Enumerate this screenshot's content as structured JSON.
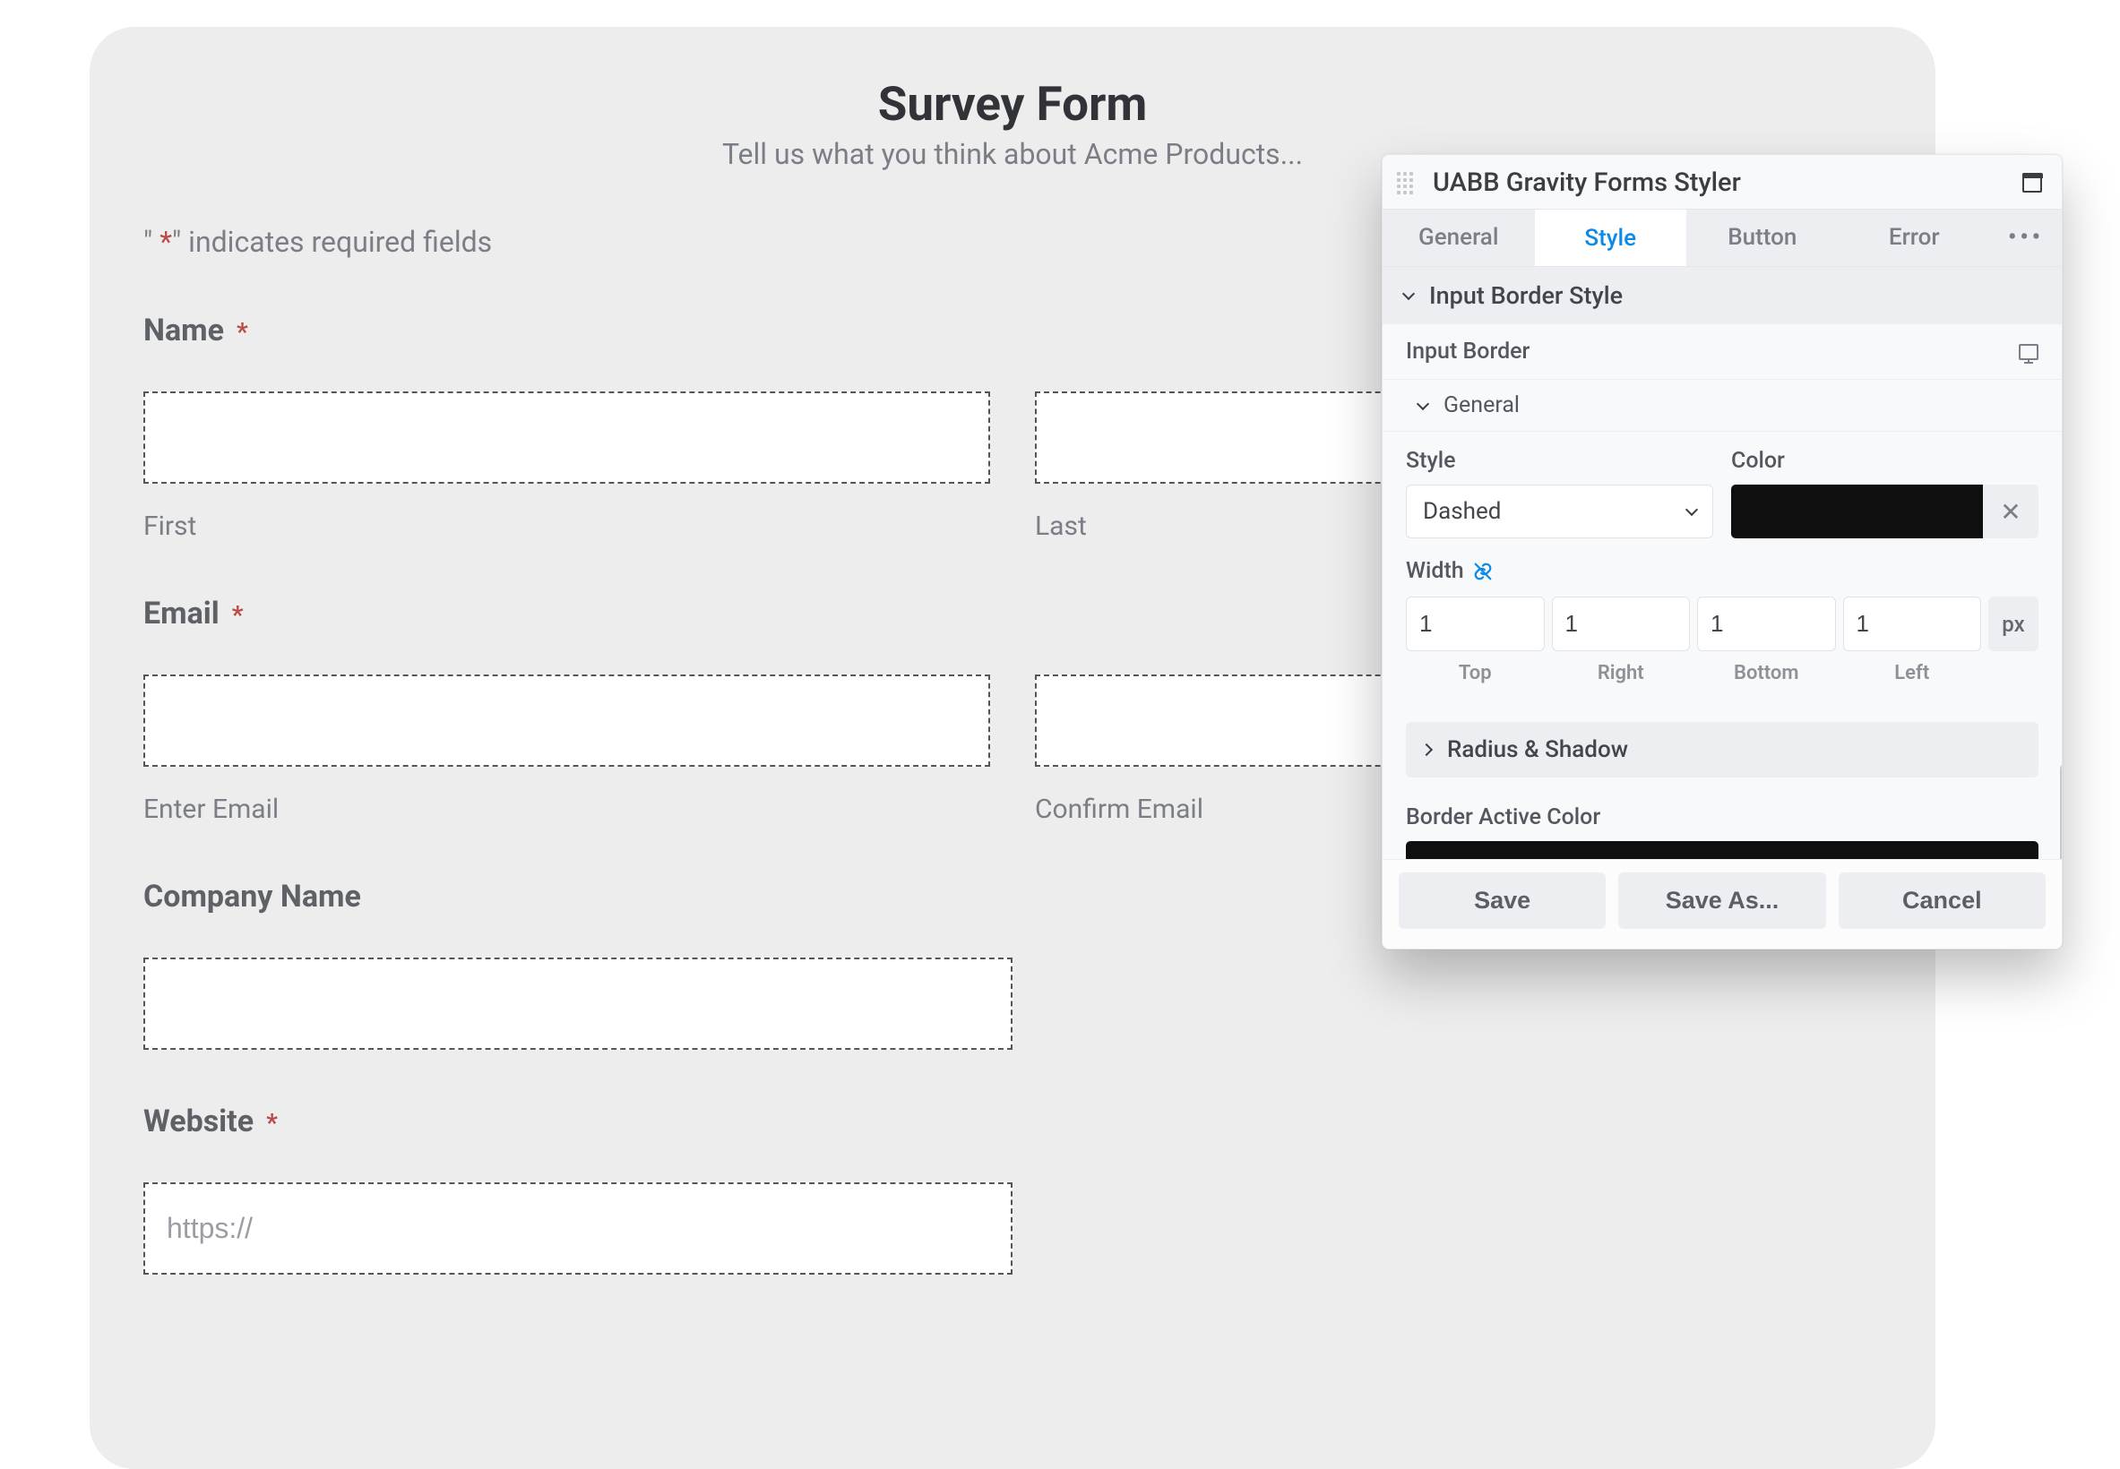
{
  "form": {
    "title": "Survey Form",
    "description": "Tell us what you think about Acme Products...",
    "required_prefix": "\" ",
    "required_asterisk": "*",
    "required_suffix": "\" indicates required fields",
    "fields": {
      "name": {
        "label": "Name",
        "first_sub": "First",
        "last_sub": "Last"
      },
      "email": {
        "label": "Email",
        "enter_sub": "Enter Email",
        "confirm_sub": "Confirm Email"
      },
      "company": {
        "label": "Company Name"
      },
      "website": {
        "label": "Website",
        "placeholder": "https://"
      }
    }
  },
  "panel": {
    "title": "UABB Gravity Forms Styler",
    "tabs": {
      "general": "General",
      "style": "Style",
      "button": "Button",
      "error": "Error",
      "more": "•••"
    },
    "section_input_border": "Input Border Style",
    "row_input_border": "Input Border",
    "sub_general": "General",
    "style_label": "Style",
    "style_value": "Dashed",
    "color_label": "Color",
    "color_value": "#000000",
    "width_label": "Width",
    "width": {
      "top": "1",
      "right": "1",
      "bottom": "1",
      "left": "1",
      "unit": "px"
    },
    "width_sides": {
      "top": "Top",
      "right": "Right",
      "bottom": "Bottom",
      "left": "Left"
    },
    "radius_shadow": "Radius & Shadow",
    "active_color_label": "Border Active Color",
    "footer": {
      "save": "Save",
      "save_as": "Save As...",
      "cancel": "Cancel"
    }
  }
}
